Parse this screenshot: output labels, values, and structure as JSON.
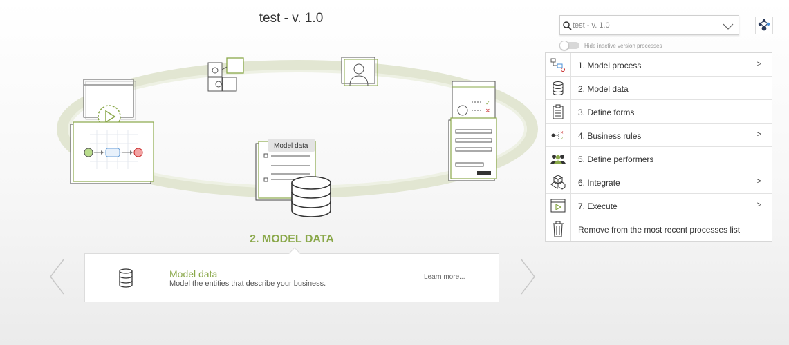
{
  "header": {
    "title": "test - v. 1.0"
  },
  "diagram": {
    "data_popup_label": "Model data"
  },
  "current_step": {
    "caption": "2. MODEL DATA",
    "title": "Model data",
    "description": "Model the entities that describe your business.",
    "learn_more": "Learn more..."
  },
  "process_select": {
    "value": "test - v. 1.0"
  },
  "hide_inactive": {
    "label": "Hide inactive version processes",
    "checked": false
  },
  "menu": {
    "items": [
      {
        "label": "1. Model process",
        "icon": "model-process-icon",
        "arrow": ">"
      },
      {
        "label": "2. Model data",
        "icon": "database-icon",
        "arrow": ""
      },
      {
        "label": "3. Define forms",
        "icon": "form-icon",
        "arrow": ""
      },
      {
        "label": "4. Business rules",
        "icon": "business-rules-icon",
        "arrow": ">"
      },
      {
        "label": "5. Define performers",
        "icon": "performers-icon",
        "arrow": ""
      },
      {
        "label": "6. Integrate",
        "icon": "integrate-icon",
        "arrow": ">"
      },
      {
        "label": "7. Execute",
        "icon": "execute-icon",
        "arrow": ">"
      },
      {
        "label": "Remove from the most recent processes list",
        "icon": "trash-icon",
        "arrow": ""
      }
    ]
  },
  "colors": {
    "accent": "#8aa84a",
    "start_node": "#9ccc65",
    "end_node": "#e57373",
    "task_node": "#6aa0d8"
  }
}
